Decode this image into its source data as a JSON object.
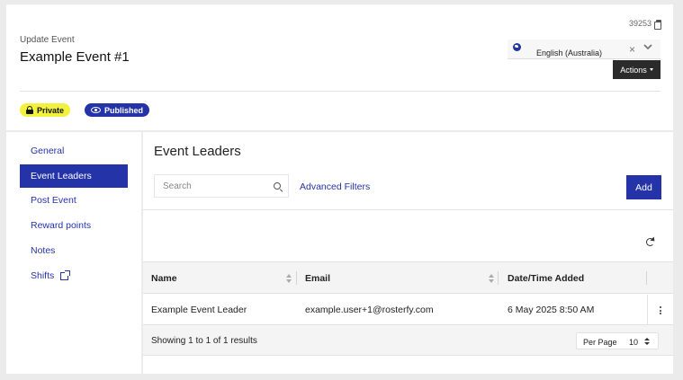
{
  "header": {
    "event_id": "39253",
    "update_label": "Update Event",
    "title": "Example Event #1",
    "language": "English (Australia)",
    "actions_label": "Actions"
  },
  "badges": {
    "private": "Private",
    "published": "Published",
    "private_color": "#f2f23c",
    "published_color": "#2433a8"
  },
  "sidebar": {
    "items": [
      {
        "label": "General",
        "active": false
      },
      {
        "label": "Event Leaders",
        "active": true
      },
      {
        "label": "Post Event",
        "active": false
      },
      {
        "label": "Reward points",
        "active": false
      },
      {
        "label": "Notes",
        "active": false
      },
      {
        "label": "Shifts",
        "active": false,
        "icon": "external-link-icon"
      }
    ]
  },
  "main": {
    "section_title": "Event Leaders",
    "search_placeholder": "Search",
    "advanced_filters": "Advanced Filters",
    "add_label": "Add",
    "table": {
      "columns": [
        "Name",
        "Email",
        "Date/Time Added"
      ],
      "rows": [
        {
          "name": "Example Event Leader",
          "email": "example.user+1@rosterfy.com",
          "added": "6 May 2025 8:50 AM"
        }
      ]
    },
    "footer": {
      "results_text": "Showing 1 to 1 of 1 results",
      "per_page_label": "Per Page",
      "per_page_value": "10"
    }
  },
  "accent_color": "#2433a8"
}
